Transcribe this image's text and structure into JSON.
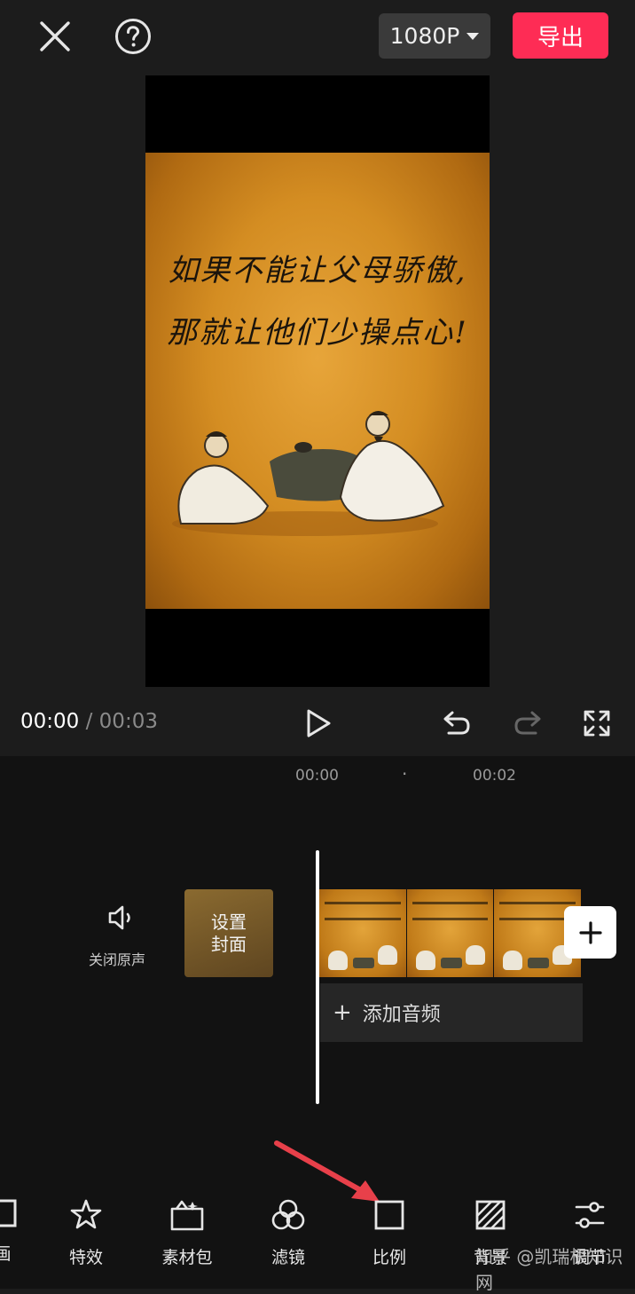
{
  "header": {
    "resolution": "1080P",
    "export_label": "导出"
  },
  "preview": {
    "line1": "如果不能让父母骄傲,",
    "line2": "那就让他们少操点心!"
  },
  "playback": {
    "current_time": "00:00",
    "separator": " / ",
    "total_time": "00:03"
  },
  "timeline": {
    "ruler": [
      "00:00",
      "·",
      "00:02"
    ],
    "mute_label": "关闭原声",
    "cover_line1": "设置",
    "cover_line2": "封面",
    "add_audio_label": "添加音频"
  },
  "toolbar": {
    "items": [
      {
        "label": "画",
        "icon": "canvas-icon"
      },
      {
        "label": "特效",
        "icon": "effects-star-icon"
      },
      {
        "label": "素材包",
        "icon": "material-pack-icon"
      },
      {
        "label": "滤镜",
        "icon": "filter-icon"
      },
      {
        "label": "比例",
        "icon": "ratio-square-icon"
      },
      {
        "label": "背景",
        "icon": "background-icon"
      },
      {
        "label": "调节",
        "icon": "adjust-sliders-icon"
      }
    ]
  },
  "watermark": "知乎 @凯瑞根知识网",
  "colors": {
    "accent": "#fe2c55",
    "annotation_arrow": "#e8404a"
  }
}
